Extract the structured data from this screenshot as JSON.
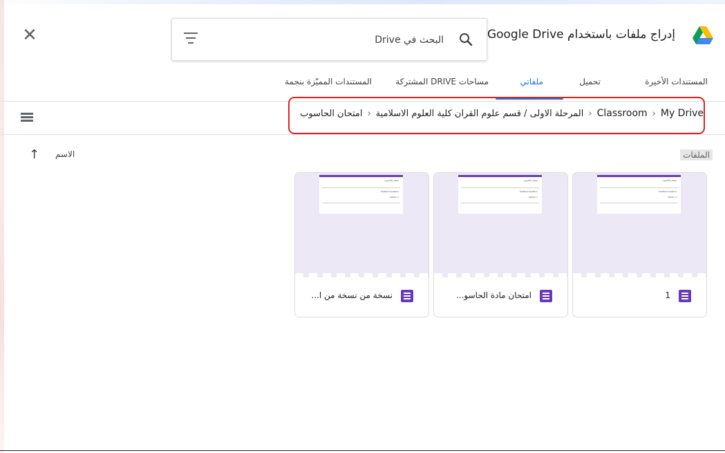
{
  "header": {
    "title": "إدراج ملفات باستخدام Google Drive",
    "search_placeholder": "البحث في Drive",
    "close_icon": "close-icon",
    "filter_icon": "filter-icon",
    "search_icon": "search-icon",
    "logo_icon": "google-drive-logo"
  },
  "tabs": [
    {
      "label": "المستندات الأخيرة",
      "active": false
    },
    {
      "label": "تحميل",
      "active": false
    },
    {
      "label": "ملفاتي",
      "active": true
    },
    {
      "label": "مساحات DRIVE المشتركة",
      "active": false
    },
    {
      "label": "المستندات المميّزة بنجمة",
      "active": false
    }
  ],
  "breadcrumb": {
    "items": [
      "My Drive",
      "Classroom",
      "المرحلة الاولى / قسم علوم القران كلية العلوم الاسلامية",
      "امتحان الحاسوب"
    ],
    "separator": "›"
  },
  "files": {
    "section_label": "الملفات",
    "sort_label": "الاسم",
    "sort_icon": "arrow-up-icon",
    "items": [
      {
        "name": "1",
        "icon": "google-forms-icon"
      },
      {
        "name": "امتحان مادة الحاسو...",
        "icon": "google-forms-icon"
      },
      {
        "name": "نسخة من نسخة من ا...",
        "icon": "google-forms-icon"
      }
    ],
    "thumbnail_text": {
      "title": "امتحان الحاسوب",
      "line2": "Untitled Question",
      "line3": "Option 1"
    }
  },
  "colors": {
    "accent": "#1a73e8",
    "forms_purple": "#673ab7",
    "highlight_border": "#e02020"
  }
}
